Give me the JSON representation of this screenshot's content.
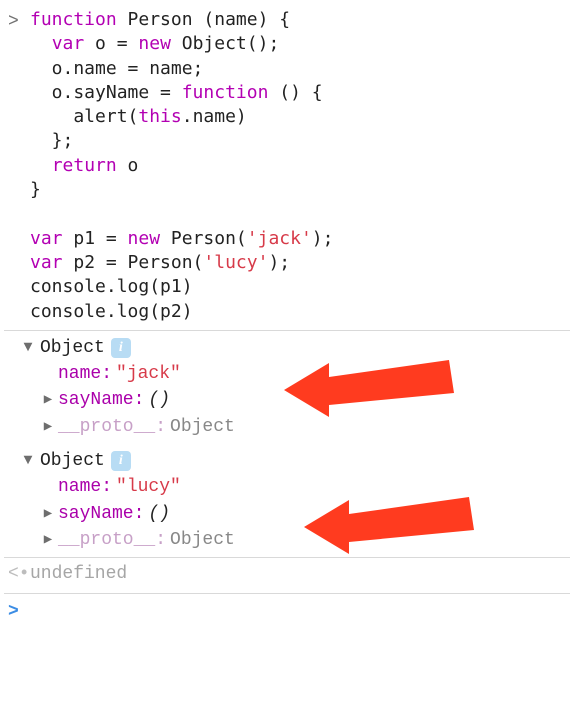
{
  "input_code": "function Person (name) {\n  var o = new Object();\n  o.name = name;\n  o.sayName = function () {\n    alert(this.name)\n  };\n  return o\n}\n\nvar p1 = new Person('jack');\nvar p2 = Person('lucy');\nconsole.log(p1)\nconsole.log(p2)",
  "objects": [
    {
      "type_label": "Object",
      "props": {
        "name_key": "name:",
        "name_val": "\"jack\"",
        "sayName_key": "sayName:",
        "sayName_val": "()",
        "proto_key": "__proto__:",
        "proto_val": "Object"
      }
    },
    {
      "type_label": "Object",
      "props": {
        "name_key": "name:",
        "name_val": "\"lucy\"",
        "sayName_key": "sayName:",
        "sayName_val": "()",
        "proto_key": "__proto__:",
        "proto_val": "Object"
      }
    }
  ],
  "return_value": "undefined",
  "info_glyph": "i"
}
